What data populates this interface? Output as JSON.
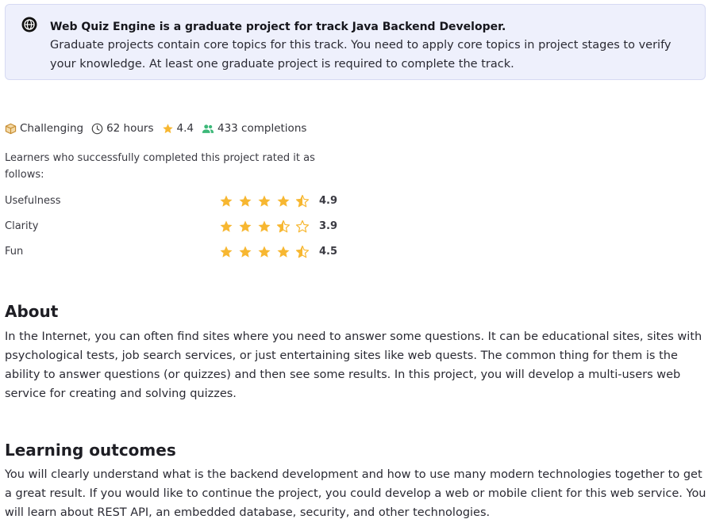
{
  "banner": {
    "title": "Web Quiz Engine is a graduate project for track Java Backend Developer.",
    "description": "Graduate projects contain core topics for this track. You need to apply core topics in project stages to verify your knowledge. At least one graduate project is required to complete the track."
  },
  "meta": {
    "difficulty": "Challenging",
    "duration": "62 hours",
    "rating": "4.4",
    "completions": "433 completions"
  },
  "ratings": {
    "intro": "Learners who successfully completed this project rated it as follows:",
    "items": [
      {
        "label": "Usefulness",
        "value": "4.9",
        "stars": 4.5
      },
      {
        "label": "Clarity",
        "value": "3.9",
        "stars": 3.5
      },
      {
        "label": "Fun",
        "value": "4.5",
        "stars": 4.5
      }
    ]
  },
  "about": {
    "heading": "About",
    "text": "In the Internet, you can often find sites where you need to answer some questions. It can be educational sites, sites with psychological tests, job search services, or just entertaining sites like web quests. The common thing for them is the ability to answer questions (or quizzes) and then see some results. In this project, you will develop a multi-users web service for creating and solving quizzes."
  },
  "outcomes": {
    "heading": "Learning outcomes",
    "text": "You will clearly understand what is the backend development and how to use many modern technologies together to get a great result. If you would like to continue the project, you could develop a web or mobile client for this web service. You will learn about REST API, an embedded database, security, and other technologies."
  },
  "colors": {
    "star": "#f7b731",
    "completions_icon": "#3cb878",
    "difficulty_icon": "#d19a3f",
    "banner_bg": "#eef0fc"
  }
}
